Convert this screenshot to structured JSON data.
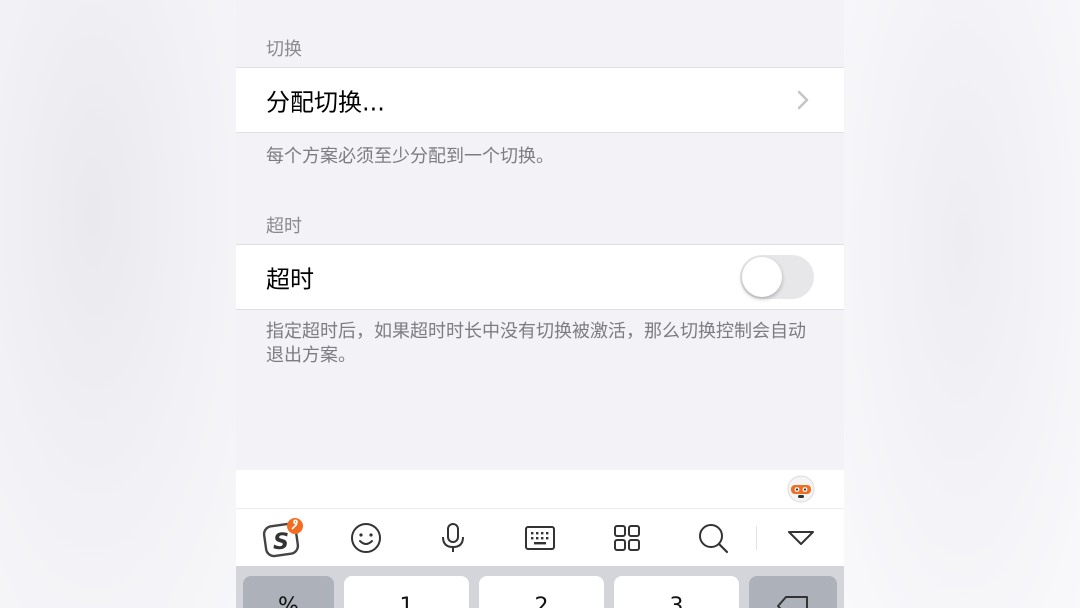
{
  "sections": {
    "switch": {
      "header": "切换",
      "cell_label": "分配切换...",
      "footer": "每个方案必须至少分配到一个切换。"
    },
    "timeout": {
      "header": "超时",
      "cell_label": "超时",
      "toggle_on": false,
      "footer": "指定超时后，如果超时时长中没有切换被激活，那么切换控制会自动退出方案。"
    }
  },
  "keyboard": {
    "toolbar_icons": [
      "sogou-logo-icon",
      "emoji-icon",
      "microphone-icon",
      "keyboard-icon",
      "grid-icon",
      "search-icon",
      "collapse-keyboard-icon"
    ],
    "keys": [
      {
        "label": "%",
        "name": "key-symbols"
      },
      {
        "label": "1",
        "name": "key-1"
      },
      {
        "label": "2",
        "name": "key-2"
      },
      {
        "label": "3",
        "name": "key-3"
      },
      {
        "label": "",
        "name": "key-backspace"
      }
    ]
  },
  "colors": {
    "background": "#f2f2f7",
    "section_text": "#8a8a8f",
    "toggle_off": "#e7e7ea",
    "brand_orange": "#f26d21"
  }
}
